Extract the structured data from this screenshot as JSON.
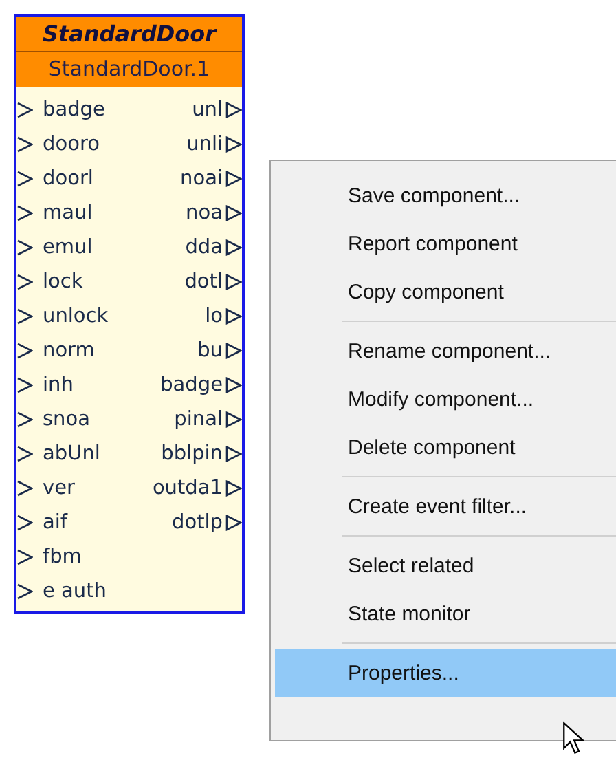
{
  "component": {
    "type_name": "StandardDoor",
    "instance_name": "StandardDoor.1",
    "input_ports": [
      "badge",
      "dooro",
      "doorl",
      "maul",
      "emul",
      "lock",
      "unlock",
      "norm",
      "inh",
      "snoa",
      "abUnl",
      "ver",
      "aif",
      "fbm",
      "e auth"
    ],
    "output_ports": [
      "unl",
      "unli",
      "noai",
      "noa",
      "dda",
      "dotl",
      "lo",
      "bu",
      "badge",
      "pinal",
      "bblpin",
      "outda1",
      "dotlp"
    ]
  },
  "context_menu": {
    "items": [
      {
        "kind": "item",
        "label": "Save component...",
        "selected": false
      },
      {
        "kind": "item",
        "label": "Report component",
        "selected": false
      },
      {
        "kind": "item",
        "label": "Copy component",
        "selected": false
      },
      {
        "kind": "separator"
      },
      {
        "kind": "item",
        "label": "Rename component...",
        "selected": false
      },
      {
        "kind": "item",
        "label": "Modify component...",
        "selected": false
      },
      {
        "kind": "item",
        "label": "Delete component",
        "selected": false
      },
      {
        "kind": "separator"
      },
      {
        "kind": "item",
        "label": "Create event filter...",
        "selected": false
      },
      {
        "kind": "separator"
      },
      {
        "kind": "item",
        "label": "Select related",
        "selected": false
      },
      {
        "kind": "item",
        "label": "State monitor",
        "selected": false
      },
      {
        "kind": "separator"
      },
      {
        "kind": "item",
        "label": "Properties...",
        "selected": true
      }
    ]
  }
}
